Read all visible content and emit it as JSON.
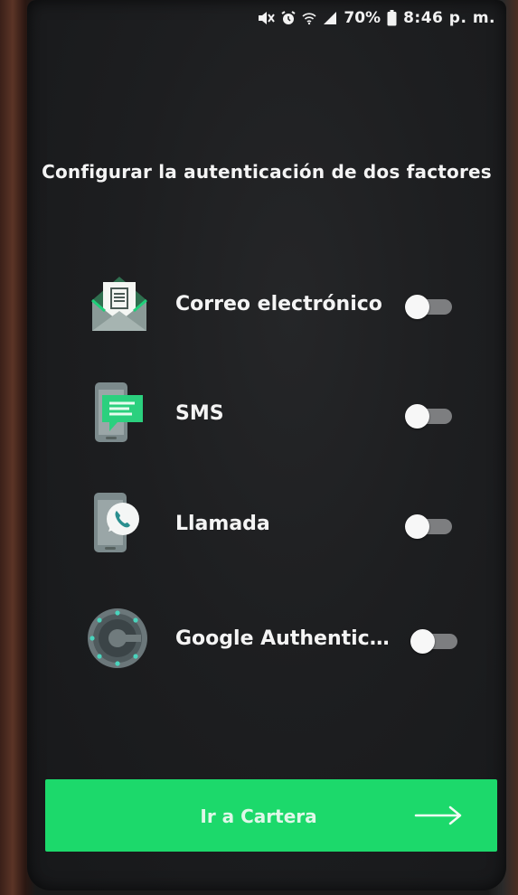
{
  "status_bar": {
    "battery": "70%",
    "time": "8:46 p. m.",
    "icons": [
      "mute-icon",
      "alarm-icon",
      "wifi-icon",
      "signal-icon",
      "battery-icon"
    ]
  },
  "page": {
    "title": "Configurar la autenticación de dos factores"
  },
  "options": [
    {
      "label": "Correo electrónico",
      "icon": "email-icon",
      "enabled": false
    },
    {
      "label": "SMS",
      "icon": "sms-icon",
      "enabled": false
    },
    {
      "label": "Llamada",
      "icon": "phone-call-icon",
      "enabled": false
    },
    {
      "label": "Google Authentica...",
      "icon": "google-authenticator-icon",
      "enabled": false
    }
  ],
  "footer": {
    "button_label": "Ir a Cartera",
    "button_icon": "arrow-right-icon"
  },
  "colors": {
    "background": "#1d1e20",
    "accent": "#1cd96b",
    "toggle_off_track": "#7d7e80",
    "text": "#f4f4f4"
  }
}
